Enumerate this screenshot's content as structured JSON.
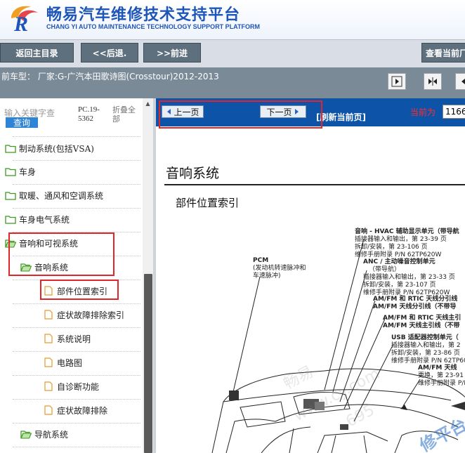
{
  "header": {
    "title_cn": "畅易汽车维修技术支持平台",
    "title_en": "CHANG YI AUTO MAINTENANCE TECHNOLOGY SUPPORT PLATFORM"
  },
  "nav": {
    "home": "返回主目录",
    "back": "<<后退.",
    "forward": ">>前进",
    "view_home": "查看当前厂"
  },
  "model": {
    "text": "前车型：  厂家:G-广汽本田歌诗图(Crosstour)2012-2013"
  },
  "left": {
    "search_placeholder": "输入关键字查",
    "search_button": "查询",
    "pc_label": "PC.19-5362",
    "collapse_all": "折叠全部",
    "tree": [
      {
        "label": "制动系统(包括VSA)",
        "type": "folder"
      },
      {
        "label": "车身",
        "type": "folder"
      },
      {
        "label": "取暖、通风和空调系统",
        "type": "folder"
      },
      {
        "label": "车身电气系统",
        "type": "folder"
      },
      {
        "label": "音响和可视系统",
        "type": "folder-open"
      },
      {
        "label": "音响系统",
        "type": "folder-open"
      },
      {
        "label": "部件位置索引",
        "type": "page"
      },
      {
        "label": "症状故障排除索引",
        "type": "page"
      },
      {
        "label": "系统说明",
        "type": "page"
      },
      {
        "label": "电路图",
        "type": "page"
      },
      {
        "label": "自诊断功能",
        "type": "page"
      },
      {
        "label": "症状故障排除",
        "type": "page"
      },
      {
        "label": "导航系统",
        "type": "folder-open"
      }
    ]
  },
  "docbar": {
    "prev": "上一页",
    "next": "下一页",
    "refresh": "[刷新当前页]",
    "page_label": "当前为",
    "page_value": "1166"
  },
  "doc": {
    "title": "音响系统",
    "subtitle": "部件位置索引",
    "watermark_1": "畅易",
    "watermark_2": "www.cy.com",
    "watermark_3": "695",
    "watermark_4": "修平台",
    "callouts": {
      "pcm_1": "PCM",
      "pcm_2": "(发动机转速脉冲和",
      "pcm_3": "车速脉冲)",
      "hvac_1": "音响 - HVAC 辅助显示单元（带导航",
      "hvac_2": "插接器输入和输出，第 23-39 页",
      "hvac_3": "拆卸/安装，第 23-106 页",
      "hvac_4": "维修手册附录 P/N 62TP620W",
      "anc_1": "ANC / 主动噪音控制单元",
      "anc_2": "（带导航）",
      "anc_3": "插接器输入和输出，第 23-33 页",
      "anc_4": "拆卸/安装，第 23-107 页",
      "anc_5": "维修手册附录 P/N 62TP620W",
      "amfm1_1": "AM/FM 和 RTIC 天线分引线",
      "amfm1_2": "AM/FM 天线分引线（不带导",
      "amfm2_1": "AM/FM 和 RTIC 天线主引",
      "amfm2_2": "AM/FM 天线主引线（不带",
      "usb_1": "USB 适配器控制单元（",
      "usb_2": "插接器输入和输出，第 2",
      "usb_3": "拆卸/安装，第 23-86 页",
      "usb_4": "维修手册附录 P/N 62TP600",
      "ant_1": "AM/FM 天线",
      "ant_2": "更换，第 23-91 页",
      "ant_3": "维修手册附录 P/N 6"
    }
  },
  "colors": {
    "brand_blue": "#1d56b8",
    "nav_button": "#5e6f7d",
    "model_bar": "#7b8a97",
    "doc_bar": "#0d54a8",
    "highlight_red": "#e0262b",
    "folder_green": "#3c9a1f",
    "page_orange": "#e69a2b"
  }
}
